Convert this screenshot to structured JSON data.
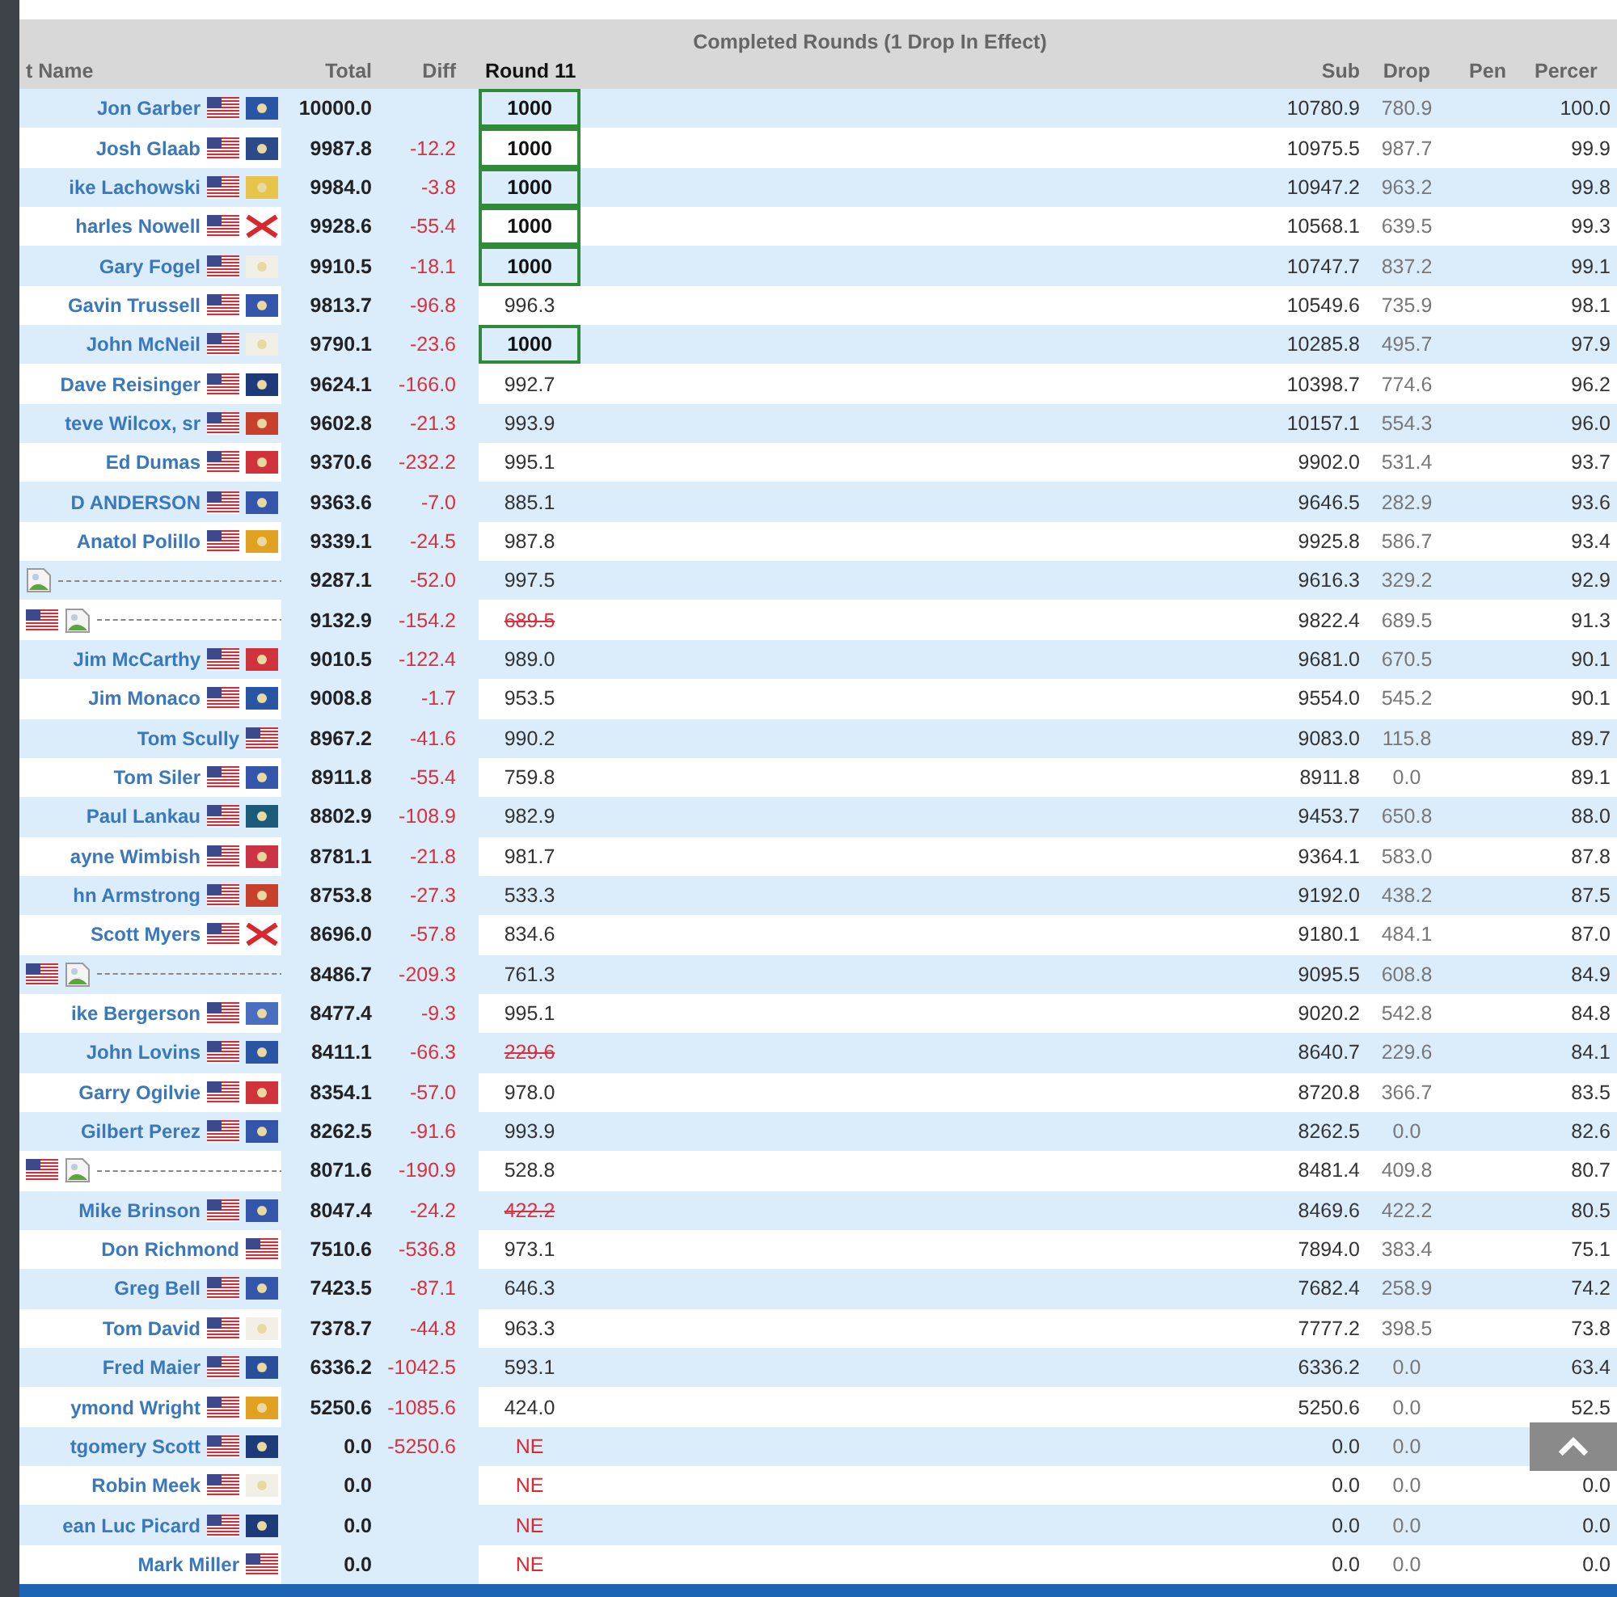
{
  "table": {
    "group_header": "Completed Rounds (1 Drop In Effect)",
    "columns": {
      "name": "t Name",
      "total": "Total",
      "diff": "Diff",
      "round": "Round 11",
      "sub": "Sub",
      "drop": "Drop",
      "pen": "Pen",
      "percent": "Percer"
    },
    "rows": [
      {
        "name": "Jon Garber",
        "flags": [
          {
            "kind": "us"
          },
          {
            "kind": "state",
            "color": "#2a55a4"
          }
        ],
        "total": "10000.0",
        "diff": "",
        "round": {
          "value": "1000",
          "kind": "best"
        },
        "sub": "10780.9",
        "drop": "780.9",
        "percent": "100.0"
      },
      {
        "name": "Josh Glaab",
        "flags": [
          {
            "kind": "us"
          },
          {
            "kind": "state",
            "color": "#2b4a8a"
          }
        ],
        "total": "9987.8",
        "diff": "-12.2",
        "round": {
          "value": "1000",
          "kind": "best"
        },
        "sub": "10975.5",
        "drop": "987.7",
        "percent": "99.9"
      },
      {
        "name": "ike Lachowski",
        "flags": [
          {
            "kind": "us"
          },
          {
            "kind": "state",
            "color": "#e8c44a"
          }
        ],
        "total": "9984.0",
        "diff": "-3.8",
        "round": {
          "value": "1000",
          "kind": "best"
        },
        "sub": "10947.2",
        "drop": "963.2",
        "percent": "99.8"
      },
      {
        "name": "harles Nowell",
        "flags": [
          {
            "kind": "us"
          },
          {
            "kind": "saltire"
          }
        ],
        "total": "9928.6",
        "diff": "-55.4",
        "round": {
          "value": "1000",
          "kind": "best"
        },
        "sub": "10568.1",
        "drop": "639.5",
        "percent": "99.3"
      },
      {
        "name": "Gary Fogel",
        "flags": [
          {
            "kind": "us"
          },
          {
            "kind": "state",
            "color": "#f2efe6"
          }
        ],
        "total": "9910.5",
        "diff": "-18.1",
        "round": {
          "value": "1000",
          "kind": "best"
        },
        "sub": "10747.7",
        "drop": "837.2",
        "percent": "99.1"
      },
      {
        "name": "Gavin Trussell",
        "flags": [
          {
            "kind": "us"
          },
          {
            "kind": "state",
            "color": "#3355aa"
          }
        ],
        "total": "9813.7",
        "diff": "-96.8",
        "round": {
          "value": "996.3",
          "kind": "normal"
        },
        "sub": "10549.6",
        "drop": "735.9",
        "percent": "98.1"
      },
      {
        "name": "John McNeil",
        "flags": [
          {
            "kind": "us"
          },
          {
            "kind": "state",
            "color": "#f2efe6"
          }
        ],
        "total": "9790.1",
        "diff": "-23.6",
        "round": {
          "value": "1000",
          "kind": "best"
        },
        "sub": "10285.8",
        "drop": "495.7",
        "percent": "97.9"
      },
      {
        "name": "Dave Reisinger",
        "flags": [
          {
            "kind": "us"
          },
          {
            "kind": "state",
            "color": "#1d3b7a"
          }
        ],
        "total": "9624.1",
        "diff": "-166.0",
        "round": {
          "value": "992.7",
          "kind": "normal"
        },
        "sub": "10398.7",
        "drop": "774.6",
        "percent": "96.2"
      },
      {
        "name": "teve Wilcox, sr",
        "flags": [
          {
            "kind": "us"
          },
          {
            "kind": "state",
            "color": "#c8402c"
          }
        ],
        "total": "9602.8",
        "diff": "-21.3",
        "round": {
          "value": "993.9",
          "kind": "normal"
        },
        "sub": "10157.1",
        "drop": "554.3",
        "percent": "96.0"
      },
      {
        "name": "Ed Dumas",
        "flags": [
          {
            "kind": "us"
          },
          {
            "kind": "state",
            "color": "#d0333c"
          }
        ],
        "total": "9370.6",
        "diff": "-232.2",
        "round": {
          "value": "995.1",
          "kind": "normal"
        },
        "sub": "9902.0",
        "drop": "531.4",
        "percent": "93.7"
      },
      {
        "name": "D ANDERSON",
        "flags": [
          {
            "kind": "us"
          },
          {
            "kind": "state",
            "color": "#3355aa"
          }
        ],
        "total": "9363.6",
        "diff": "-7.0",
        "round": {
          "value": "885.1",
          "kind": "normal"
        },
        "sub": "9646.5",
        "drop": "282.9",
        "percent": "93.6"
      },
      {
        "name": "Anatol Polillo",
        "flags": [
          {
            "kind": "us"
          },
          {
            "kind": "state",
            "color": "#e0a020"
          }
        ],
        "total": "9339.1",
        "diff": "-24.5",
        "round": {
          "value": "987.8",
          "kind": "normal"
        },
        "sub": "9925.8",
        "drop": "586.7",
        "percent": "93.4"
      },
      {
        "name": "",
        "flags": [
          {
            "kind": "broken"
          }
        ],
        "total": "9287.1",
        "diff": "-52.0",
        "round": {
          "value": "997.5",
          "kind": "normal"
        },
        "sub": "9616.3",
        "drop": "329.2",
        "percent": "92.9"
      },
      {
        "name": "",
        "flags": [
          {
            "kind": "us"
          },
          {
            "kind": "broken"
          }
        ],
        "total": "9132.9",
        "diff": "-154.2",
        "round": {
          "value": "689.5",
          "kind": "dropped"
        },
        "sub": "9822.4",
        "drop": "689.5",
        "percent": "91.3"
      },
      {
        "name": "Jim McCarthy",
        "flags": [
          {
            "kind": "us"
          },
          {
            "kind": "state",
            "color": "#d0333c"
          }
        ],
        "total": "9010.5",
        "diff": "-122.4",
        "round": {
          "value": "989.0",
          "kind": "normal"
        },
        "sub": "9681.0",
        "drop": "670.5",
        "percent": "90.1"
      },
      {
        "name": "Jim Monaco",
        "flags": [
          {
            "kind": "us"
          },
          {
            "kind": "state",
            "color": "#2a55a4"
          }
        ],
        "total": "9008.8",
        "diff": "-1.7",
        "round": {
          "value": "953.5",
          "kind": "normal"
        },
        "sub": "9554.0",
        "drop": "545.2",
        "percent": "90.1"
      },
      {
        "name": "Tom Scully",
        "flags": [
          {
            "kind": "us"
          }
        ],
        "total": "8967.2",
        "diff": "-41.6",
        "round": {
          "value": "990.2",
          "kind": "normal"
        },
        "sub": "9083.0",
        "drop": "115.8",
        "percent": "89.7"
      },
      {
        "name": "Tom Siler",
        "flags": [
          {
            "kind": "us"
          },
          {
            "kind": "state",
            "color": "#3355aa"
          }
        ],
        "total": "8911.8",
        "diff": "-55.4",
        "round": {
          "value": "759.8",
          "kind": "normal"
        },
        "sub": "8911.8",
        "drop": "0.0",
        "percent": "89.1"
      },
      {
        "name": "Paul Lankau",
        "flags": [
          {
            "kind": "us"
          },
          {
            "kind": "state",
            "color": "#1a5a7a"
          }
        ],
        "total": "8802.9",
        "diff": "-108.9",
        "round": {
          "value": "982.9",
          "kind": "normal"
        },
        "sub": "9453.7",
        "drop": "650.8",
        "percent": "88.0"
      },
      {
        "name": "ayne Wimbish",
        "flags": [
          {
            "kind": "us"
          },
          {
            "kind": "state",
            "color": "#cc3344"
          }
        ],
        "total": "8781.1",
        "diff": "-21.8",
        "round": {
          "value": "981.7",
          "kind": "normal"
        },
        "sub": "9364.1",
        "drop": "583.0",
        "percent": "87.8"
      },
      {
        "name": "hn Armstrong",
        "flags": [
          {
            "kind": "us"
          },
          {
            "kind": "state",
            "color": "#c8402c"
          }
        ],
        "total": "8753.8",
        "diff": "-27.3",
        "round": {
          "value": "533.3",
          "kind": "normal"
        },
        "sub": "9192.0",
        "drop": "438.2",
        "percent": "87.5"
      },
      {
        "name": "Scott Myers",
        "flags": [
          {
            "kind": "us"
          },
          {
            "kind": "saltire"
          }
        ],
        "total": "8696.0",
        "diff": "-57.8",
        "round": {
          "value": "834.6",
          "kind": "normal"
        },
        "sub": "9180.1",
        "drop": "484.1",
        "percent": "87.0"
      },
      {
        "name": "",
        "flags": [
          {
            "kind": "us"
          },
          {
            "kind": "broken"
          }
        ],
        "total": "8486.7",
        "diff": "-209.3",
        "round": {
          "value": "761.3",
          "kind": "normal"
        },
        "sub": "9095.5",
        "drop": "608.8",
        "percent": "84.9"
      },
      {
        "name": "ike Bergerson",
        "flags": [
          {
            "kind": "us"
          },
          {
            "kind": "state",
            "color": "#4a6fc0"
          }
        ],
        "total": "8477.4",
        "diff": "-9.3",
        "round": {
          "value": "995.1",
          "kind": "normal"
        },
        "sub": "9020.2",
        "drop": "542.8",
        "percent": "84.8"
      },
      {
        "name": "John Lovins",
        "flags": [
          {
            "kind": "us"
          },
          {
            "kind": "state",
            "color": "#2a55a4"
          }
        ],
        "total": "8411.1",
        "diff": "-66.3",
        "round": {
          "value": "229.6",
          "kind": "dropped"
        },
        "sub": "8640.7",
        "drop": "229.6",
        "percent": "84.1"
      },
      {
        "name": "Garry Ogilvie",
        "flags": [
          {
            "kind": "us"
          },
          {
            "kind": "state",
            "color": "#d0333c"
          }
        ],
        "total": "8354.1",
        "diff": "-57.0",
        "round": {
          "value": "978.0",
          "kind": "normal"
        },
        "sub": "8720.8",
        "drop": "366.7",
        "percent": "83.5"
      },
      {
        "name": "Gilbert Perez",
        "flags": [
          {
            "kind": "us"
          },
          {
            "kind": "state",
            "color": "#3355aa"
          }
        ],
        "total": "8262.5",
        "diff": "-91.6",
        "round": {
          "value": "993.9",
          "kind": "normal"
        },
        "sub": "8262.5",
        "drop": "0.0",
        "percent": "82.6"
      },
      {
        "name": "",
        "flags": [
          {
            "kind": "us"
          },
          {
            "kind": "broken"
          }
        ],
        "total": "8071.6",
        "diff": "-190.9",
        "round": {
          "value": "528.8",
          "kind": "normal"
        },
        "sub": "8481.4",
        "drop": "409.8",
        "percent": "80.7"
      },
      {
        "name": "Mike Brinson",
        "flags": [
          {
            "kind": "us"
          },
          {
            "kind": "state",
            "color": "#3355aa"
          }
        ],
        "total": "8047.4",
        "diff": "-24.2",
        "round": {
          "value": "422.2",
          "kind": "dropped"
        },
        "sub": "8469.6",
        "drop": "422.2",
        "percent": "80.5"
      },
      {
        "name": "Don Richmond",
        "flags": [
          {
            "kind": "us"
          }
        ],
        "total": "7510.6",
        "diff": "-536.8",
        "round": {
          "value": "973.1",
          "kind": "normal"
        },
        "sub": "7894.0",
        "drop": "383.4",
        "percent": "75.1"
      },
      {
        "name": "Greg Bell",
        "flags": [
          {
            "kind": "us"
          },
          {
            "kind": "state",
            "color": "#3355aa"
          }
        ],
        "total": "7423.5",
        "diff": "-87.1",
        "round": {
          "value": "646.3",
          "kind": "normal"
        },
        "sub": "7682.4",
        "drop": "258.9",
        "percent": "74.2"
      },
      {
        "name": "Tom David",
        "flags": [
          {
            "kind": "us"
          },
          {
            "kind": "state",
            "color": "#f2efe6"
          }
        ],
        "total": "7378.7",
        "diff": "-44.8",
        "round": {
          "value": "963.3",
          "kind": "normal"
        },
        "sub": "7777.2",
        "drop": "398.5",
        "percent": "73.8"
      },
      {
        "name": "Fred Maier",
        "flags": [
          {
            "kind": "us"
          },
          {
            "kind": "state",
            "color": "#2a4f9a"
          }
        ],
        "total": "6336.2",
        "diff": "-1042.5",
        "round": {
          "value": "593.1",
          "kind": "normal"
        },
        "sub": "6336.2",
        "drop": "0.0",
        "percent": "63.4"
      },
      {
        "name": "ymond Wright",
        "flags": [
          {
            "kind": "us"
          },
          {
            "kind": "state",
            "color": "#e0a020"
          }
        ],
        "total": "5250.6",
        "diff": "-1085.6",
        "round": {
          "value": "424.0",
          "kind": "normal"
        },
        "sub": "5250.6",
        "drop": "0.0",
        "percent": "52.5"
      },
      {
        "name": "tgomery Scott",
        "flags": [
          {
            "kind": "us"
          },
          {
            "kind": "state",
            "color": "#1d3b7a"
          }
        ],
        "total": "0.0",
        "diff": "-5250.6",
        "round": {
          "value": "NE",
          "kind": "ne"
        },
        "sub": "0.0",
        "drop": "0.0"
      },
      {
        "name": "Robin Meek",
        "flags": [
          {
            "kind": "us"
          },
          {
            "kind": "state",
            "color": "#f2efe6"
          }
        ],
        "total": "0.0",
        "diff": "",
        "round": {
          "value": "NE",
          "kind": "ne"
        },
        "sub": "0.0",
        "drop": "0.0",
        "percent": "0.0"
      },
      {
        "name": "ean Luc Picard",
        "flags": [
          {
            "kind": "us"
          },
          {
            "kind": "state",
            "color": "#1d3b7a"
          }
        ],
        "total": "0.0",
        "diff": "",
        "round": {
          "value": "NE",
          "kind": "ne"
        },
        "sub": "0.0",
        "drop": "0.0",
        "percent": "0.0"
      },
      {
        "name": "Mark Miller",
        "flags": [
          {
            "kind": "us"
          }
        ],
        "total": "0.0",
        "diff": "",
        "round": {
          "value": "NE",
          "kind": "ne"
        },
        "sub": "0.0",
        "drop": "0.0",
        "percent": "0.0"
      }
    ]
  }
}
